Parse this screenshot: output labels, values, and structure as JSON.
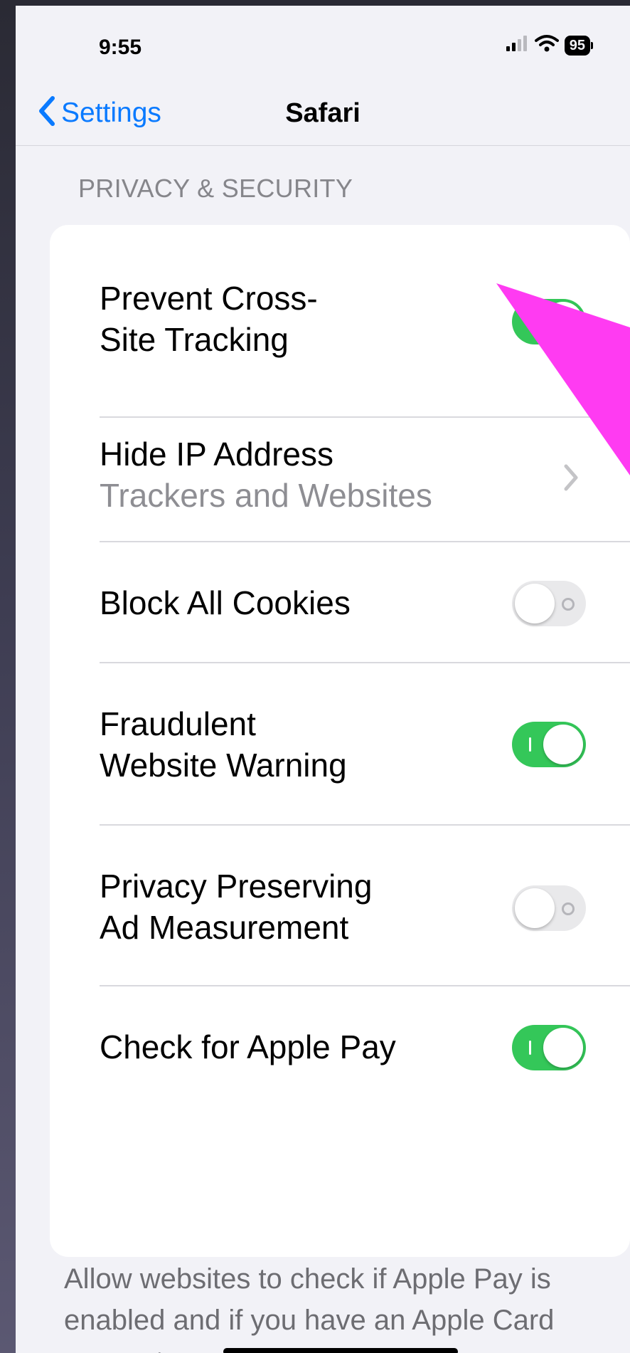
{
  "status_bar": {
    "time": "9:55",
    "battery": "95",
    "icons": [
      "cellular-signal-icon",
      "wifi-icon",
      "battery-icon"
    ]
  },
  "nav": {
    "back_label": "Settings",
    "title": "Safari"
  },
  "section": {
    "header": "PRIVACY & SECURITY",
    "rows": [
      {
        "label_line1": "Prevent Cross-",
        "label_line2": "Site Tracking",
        "type": "toggle",
        "on": true
      },
      {
        "label": "Hide IP Address",
        "sublabel": "Trackers and Websites",
        "type": "disclosure"
      },
      {
        "label": "Block All Cookies",
        "type": "toggle",
        "on": false
      },
      {
        "label_line1": "Fraudulent",
        "label_line2": "Website Warning",
        "type": "toggle",
        "on": true
      },
      {
        "label_line1": "Privacy Preserving",
        "label_line2": "Ad Measurement",
        "type": "toggle",
        "on": false
      },
      {
        "label": "Check for Apple Pay",
        "type": "toggle",
        "on": true
      }
    ]
  },
  "footer": {
    "text": "Allow websites to check if Apple Pay is enabled and if you have an Apple Card account."
  },
  "colors": {
    "accent": "#0a7aff",
    "toggle_on": "#34c759",
    "toggle_off": "#e9e9eb",
    "annotation_arrow": "#ff3bf2"
  }
}
